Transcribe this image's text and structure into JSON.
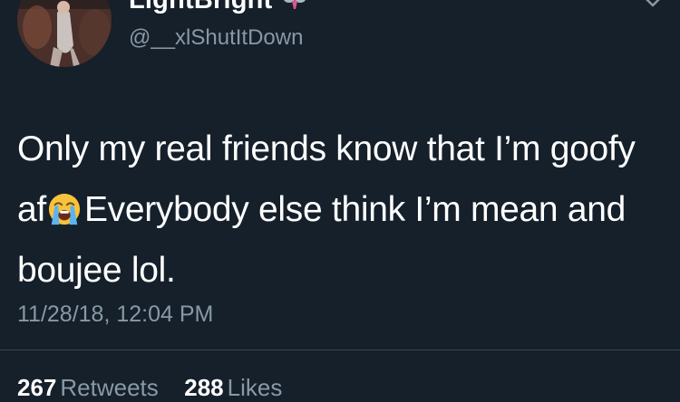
{
  "user": {
    "display_name": "LightBright",
    "handle": "@__xlShutItDown"
  },
  "tweet": {
    "lines": [
      "Only my real friends know that I’m goofy",
      "af",
      "Everybody else think I’m mean and",
      "boujee lol."
    ],
    "emoji": "loudly-crying-face-emoji",
    "timestamp": "11/28/18, 12:04 PM"
  },
  "stats": {
    "retweets_count": "267",
    "retweets_label": "Retweets",
    "likes_count": "288",
    "likes_label": "Likes"
  },
  "colors": {
    "background": "#15202b",
    "text": "#ffffff",
    "muted": "#8899a6",
    "divider": "#38444d"
  }
}
